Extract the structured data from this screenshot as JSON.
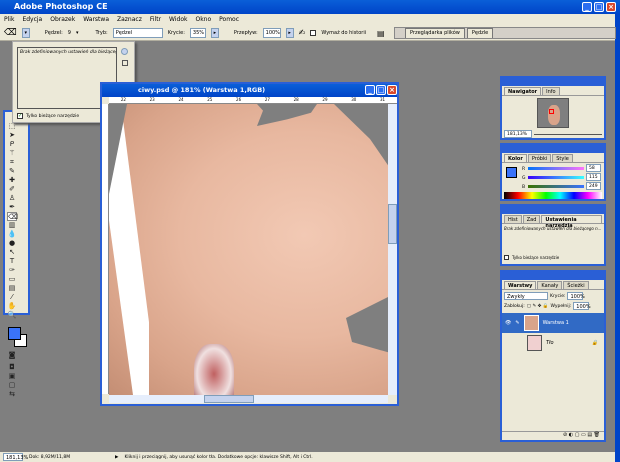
{
  "app": {
    "title": "Adobe Photoshop CE"
  },
  "menu": [
    "Plik",
    "Edycja",
    "Obrazek",
    "Warstwa",
    "Zaznacz",
    "Filtr",
    "Widok",
    "Okno",
    "Pomoc"
  ],
  "options": {
    "brush_label": "Pędzel:",
    "brush_size": "9",
    "mode_label": "Tryb:",
    "mode_value": "Pędzel",
    "opacity_label": "Krycie:",
    "opacity_value": "35%",
    "flow_label": "Przepływ:",
    "flow_value": "100%",
    "history_label": "Wymaż do historii"
  },
  "palette_well": {
    "tabs": [
      "Przeglądarka plików",
      "Pędzle"
    ]
  },
  "preset_popup": {
    "text": "Brak zdefiniowanych ustawień dla bieżącego n...",
    "checkbox_label": "Tylko bieżące narzędzie"
  },
  "document": {
    "title": "ciwy.psd @ 181% (Warstwa 1,RGB)",
    "ruler_ticks": [
      "22",
      "23",
      "24",
      "25",
      "26",
      "27",
      "28",
      "29",
      "30",
      "31"
    ]
  },
  "navigator": {
    "tabs": [
      "Nawigator",
      "Info"
    ],
    "zoom": "181,13%"
  },
  "color": {
    "tabs": [
      "Kolor",
      "Próbki",
      "Style"
    ],
    "r": "58",
    "g": "115",
    "b": "249",
    "foreground": "#3a73f9"
  },
  "tool_presets": {
    "tabs": [
      "Hist",
      "Zad",
      "Ustawienia narzędzia"
    ],
    "text": "Brak zdefiniowanych ustawień dla bieżącego n...",
    "checkbox_label": "Tylko bieżące narzędzie"
  },
  "layers": {
    "tabs": [
      "Warstwy",
      "Kanały",
      "Ścieżki"
    ],
    "blend": "Zwykły",
    "opacity_label": "Krycie:",
    "opacity": "100%",
    "lock_label": "Zablokuj:",
    "fill_label": "Wypełnij:",
    "fill": "100%",
    "items": [
      {
        "name": "Warstwa 1",
        "selected": true
      },
      {
        "name": "Tło",
        "selected": false
      }
    ]
  },
  "status": {
    "zoom": "181,13%",
    "doc": "Dok: 8,92M/11,8M",
    "hint": "Kliknij i przeciągnij, aby usunąć kolor tła. Dodatkowe opcje: klawisze Shift, Alt i Ctrl."
  }
}
